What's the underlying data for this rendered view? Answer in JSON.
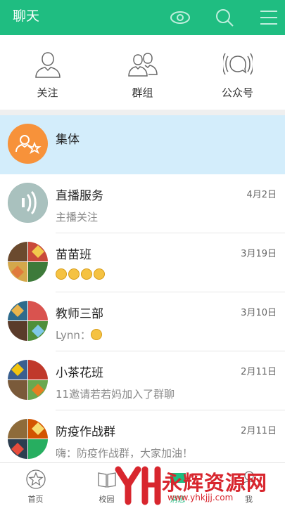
{
  "header": {
    "title": "聊天",
    "icons": [
      "eye-icon",
      "search-icon",
      "menu-icon"
    ]
  },
  "quick_access": [
    {
      "label": "关注",
      "icon": "person-icon"
    },
    {
      "label": "群组",
      "icon": "group-icon"
    },
    {
      "label": "公众号",
      "icon": "broadcast-icon"
    }
  ],
  "conversations": [
    {
      "name": "集体",
      "date": "",
      "preview": "",
      "avatar": "group-star-avatar",
      "highlighted": true
    },
    {
      "name": "直播服务",
      "date": "4月2日",
      "preview": "主播关注",
      "avatar": "live-service-avatar"
    },
    {
      "name": "苗苗班",
      "date": "3月19日",
      "preview": "",
      "preview_emoji_count": 4,
      "avatar": "photo-collage-avatar"
    },
    {
      "name": "教师三部",
      "date": "3月10日",
      "preview": "Lynn：",
      "preview_emoji_count": 1,
      "avatar": "photo-collage-avatar"
    },
    {
      "name": "小茶花班",
      "date": "2月11日",
      "preview": "11邀请若若妈加入了群聊",
      "avatar": "photo-collage-avatar"
    },
    {
      "name": "防疫作战群",
      "date": "2月11日",
      "preview": "嗨：防疫作战群，大家加油！",
      "avatar": "photo-collage-avatar"
    }
  ],
  "bottom_nav": [
    {
      "label": "首页",
      "icon": "star-icon"
    },
    {
      "label": "校园",
      "icon": "book-icon"
    },
    {
      "label": "消息",
      "icon": "message-icon",
      "active": true
    },
    {
      "label": "我",
      "icon": "person-icon"
    }
  ],
  "watermark": {
    "text": "永辉资源网",
    "url": "www.yhkjjj.com"
  },
  "colors": {
    "brand_green": "#1fbd81",
    "highlight_blue": "#d3edfb",
    "avatar_orange": "#f7923a",
    "watermark_red": "#d8262e"
  }
}
